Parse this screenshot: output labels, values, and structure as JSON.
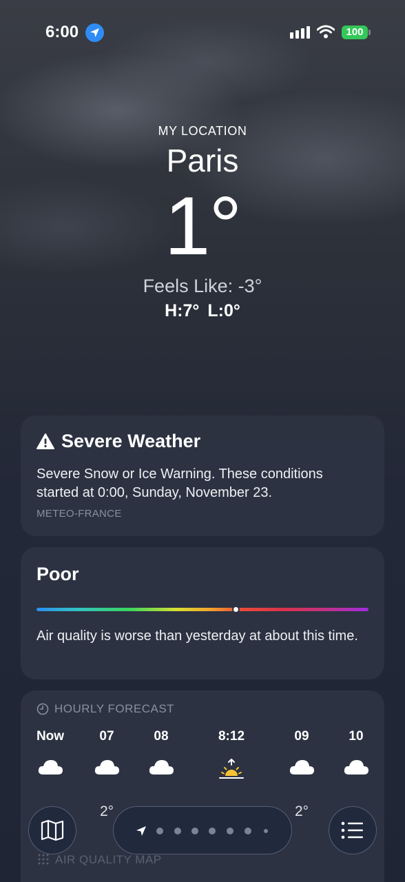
{
  "status_bar": {
    "time": "6:00",
    "battery": "100",
    "icons": [
      "location-arrow-icon",
      "cellular-signal-icon",
      "wifi-icon",
      "battery-icon"
    ]
  },
  "header": {
    "label": "MY LOCATION",
    "city": "Paris",
    "temperature": "1°",
    "feels_like": "Feels Like: -3°",
    "high": "H:7°",
    "low": "L:0°"
  },
  "severe_weather": {
    "title": "Severe Weather",
    "body": "Severe Snow or Ice Warning. These conditions started at 0:00, Sunday, November 23.",
    "source": "METEO-FRANCE",
    "icon": "warning-triangle-icon"
  },
  "air_quality": {
    "category": "Poor",
    "description": "Air quality is worse than yesterday at about this time.",
    "scale_position": 0.6
  },
  "hourly_forecast": {
    "heading": "HOURLY FORECAST",
    "hours": [
      {
        "label": "Now",
        "icon": "cloud-icon",
        "temp": ""
      },
      {
        "label": "07",
        "icon": "cloud-icon",
        "temp": "2°"
      },
      {
        "label": "08",
        "icon": "cloud-icon",
        "temp": ""
      },
      {
        "label": "8:12",
        "icon": "sunrise-icon",
        "temp": ""
      },
      {
        "label": "09",
        "icon": "cloud-icon",
        "temp": "2°"
      },
      {
        "label": "10",
        "icon": "cloud-icon",
        "temp": ""
      }
    ]
  },
  "air_quality_map": {
    "heading": "AIR QUALITY MAP"
  },
  "bottom_bar": {
    "page_count": 7,
    "icons": [
      "map-icon",
      "location-arrow-icon",
      "list-icon"
    ]
  },
  "colors": {
    "accent_blue": "#2f8cf5",
    "battery_green": "#34c759",
    "card_background": "#2e3342"
  }
}
